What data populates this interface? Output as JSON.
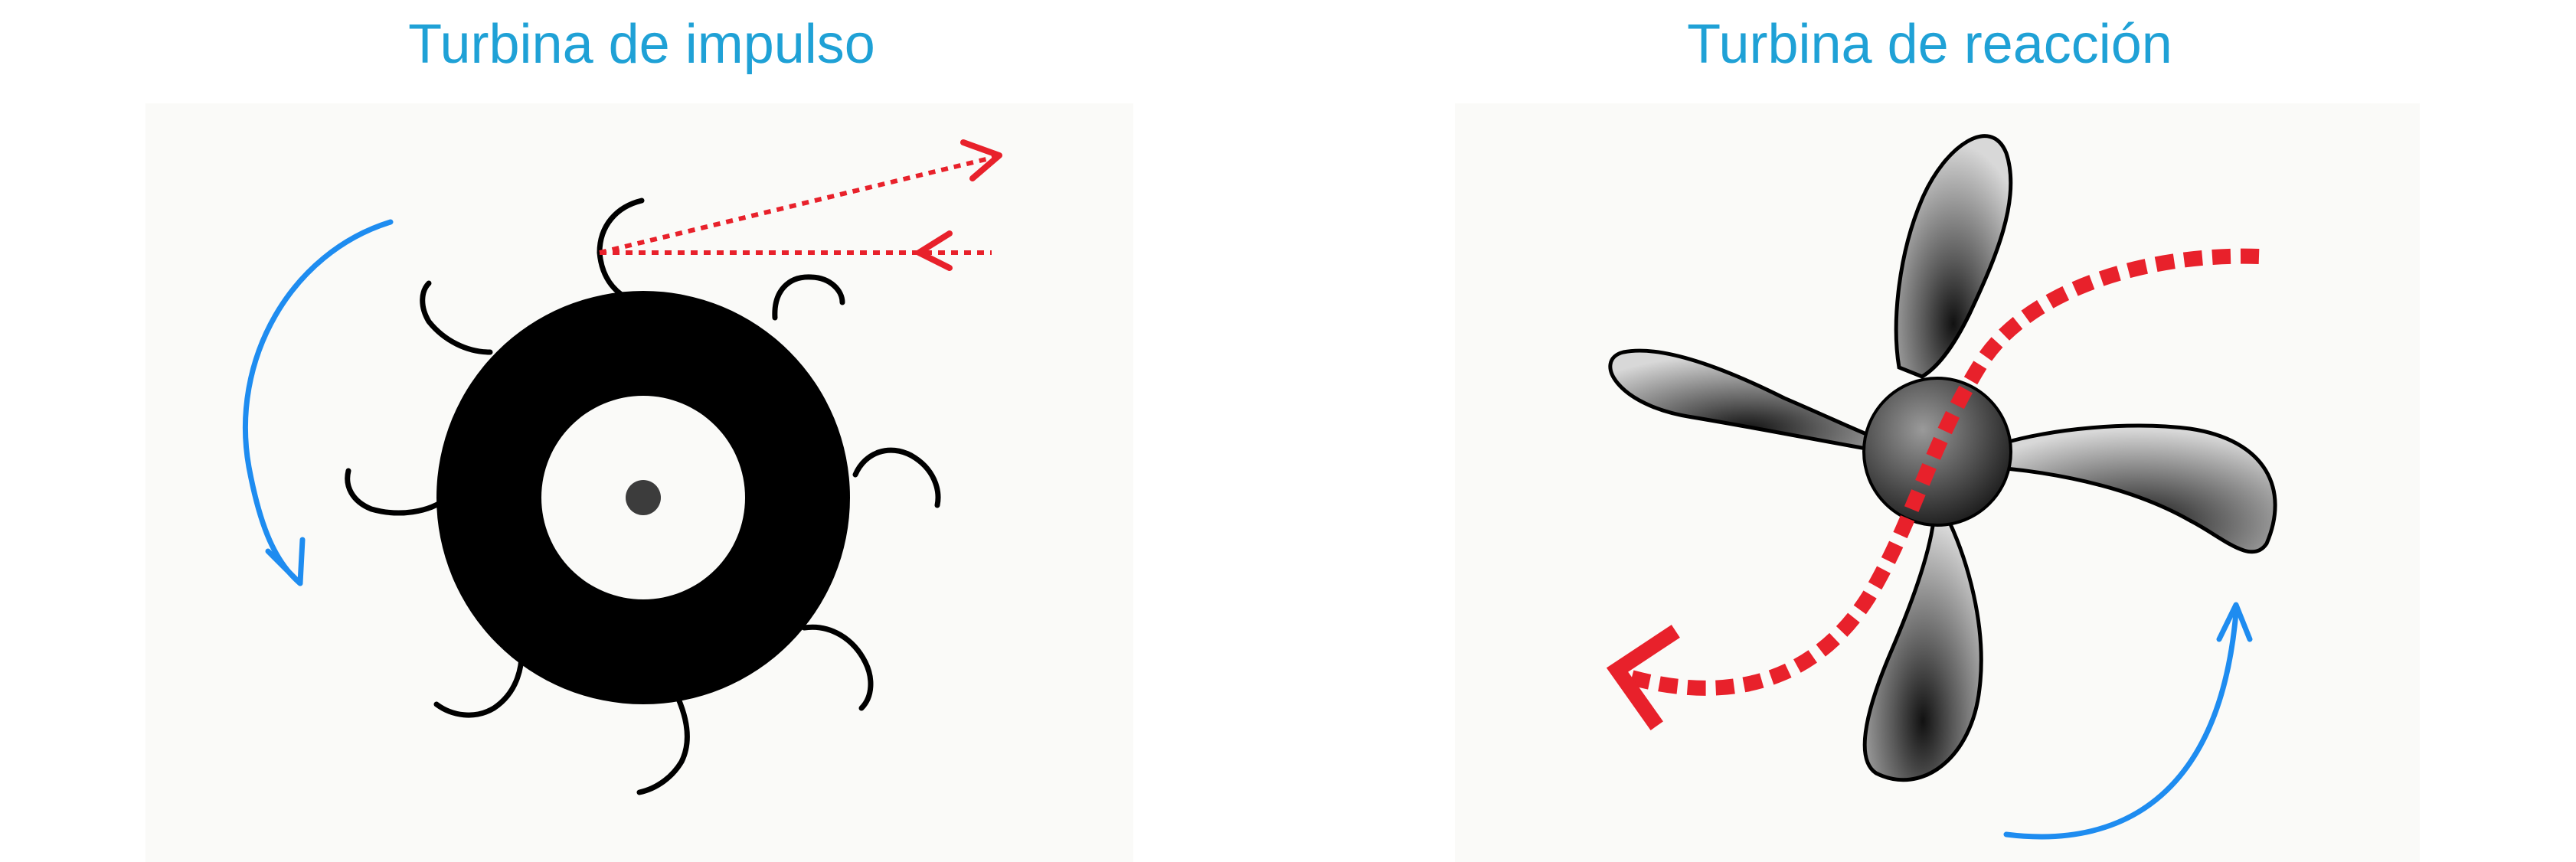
{
  "diagrams": {
    "impulse": {
      "title": "Turbina de impulso",
      "arrow_color": "#e8212b",
      "rotation_arrow_color": "#1e8cf0"
    },
    "reaction": {
      "title": "Turbina de reacción",
      "arrow_color": "#e8212b",
      "rotation_arrow_color": "#1e8cf0"
    }
  },
  "colors": {
    "title": "#1fa1d6",
    "background_panel": "#fafaf8",
    "ink": "#000000"
  },
  "icons": {
    "impulse": "impulse-turbine-wheel",
    "reaction": "propeller-turbine"
  }
}
